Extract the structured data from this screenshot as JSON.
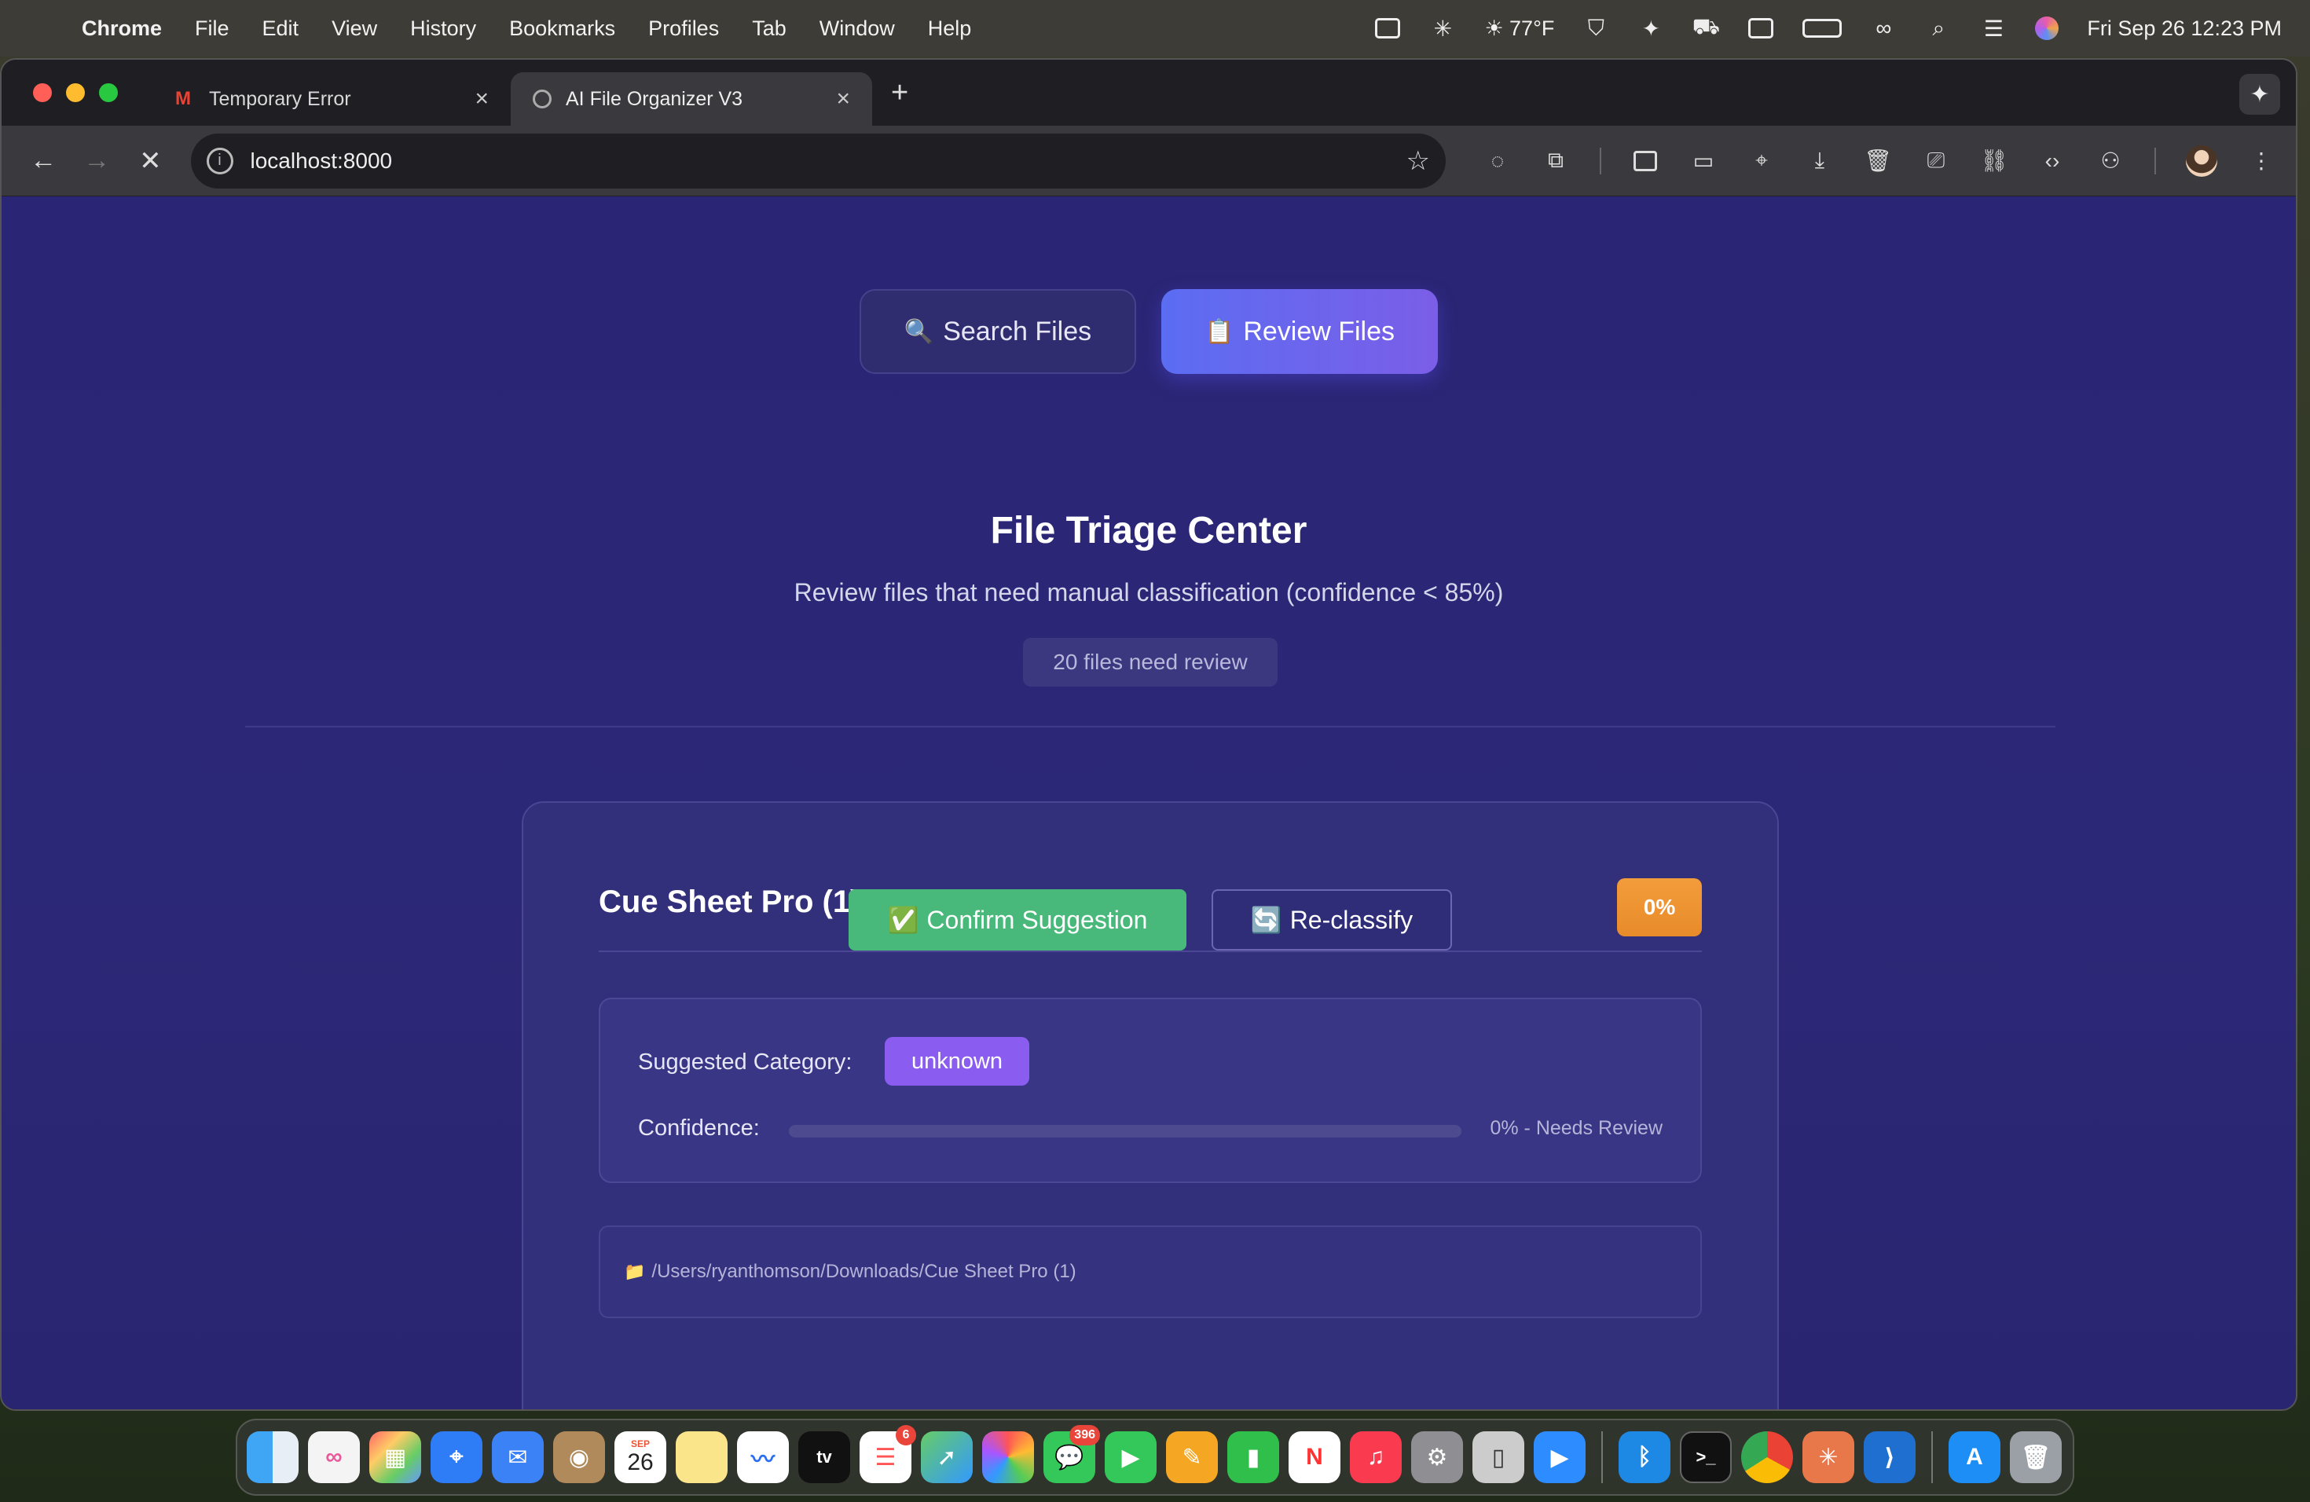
{
  "menubar": {
    "app_name": "Chrome",
    "items": [
      "File",
      "Edit",
      "View",
      "History",
      "Bookmarks",
      "Profiles",
      "Tab",
      "Window",
      "Help"
    ],
    "weather": "☀ 77°F",
    "datetime": "Fri Sep 26  12:23 PM"
  },
  "browser": {
    "tabs": [
      {
        "title": "Temporary Error",
        "favicon": "gmail-icon",
        "active": false
      },
      {
        "title": "AI File Organizer V3",
        "favicon": "globe-icon",
        "active": true
      }
    ],
    "url": "localhost:8000"
  },
  "page": {
    "mode_tabs": [
      {
        "icon": "🔍",
        "label": "Search Files"
      },
      {
        "icon": "📋",
        "label": "Review Files"
      }
    ],
    "title": "File Triage Center",
    "subtitle": "Review files that need manual classification (confidence < 85%)",
    "count_text": "20 files need review",
    "card": {
      "file_name": "Cue Sheet Pro (1)",
      "confidence_badge": "0%",
      "suggested_label": "Suggested Category:",
      "suggested_category": "unknown",
      "confidence_label": "Confidence:",
      "confidence_value": 0,
      "confidence_text": "0% - Needs Review",
      "path_icon": "📁",
      "path": "/Users/ryanthomson/Downloads/Cue Sheet Pro (1)",
      "confirm_label": "Confirm Suggestion",
      "confirm_icon": "✅",
      "reclassify_label": "Re-classify",
      "reclassify_icon": "🔄"
    }
  },
  "dock": {
    "calendar_month": "SEP",
    "calendar_day": "26",
    "reminders_badge": "6",
    "messages_badge": "396",
    "tv_label": "tv"
  },
  "colors": {
    "page_bg": "#2a2574",
    "review_btn": "#5b6df2",
    "confidence_badge": "#f39c3b",
    "category_pill": "#8a5cf0",
    "confirm_btn": "#48b97a"
  }
}
